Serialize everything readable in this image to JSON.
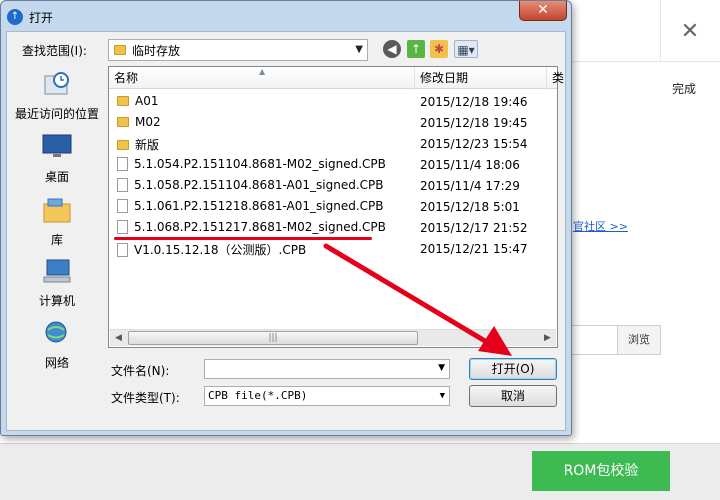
{
  "background_app": {
    "close_glyph": "✕",
    "done_label": "完成",
    "community_link": "官社区 >>",
    "browse_label": "浏览",
    "rom_button_label": "ROM包校验"
  },
  "dialog": {
    "title": "打开",
    "close_glyph": "✕",
    "look_in_label": "查找范围(I):",
    "look_in_value": "临时存放",
    "places": [
      {
        "label": "最近访问的位置"
      },
      {
        "label": "桌面"
      },
      {
        "label": "库"
      },
      {
        "label": "计算机"
      },
      {
        "label": "网络"
      }
    ],
    "columns": {
      "name": "名称",
      "date": "修改日期",
      "type": "类"
    },
    "files": [
      {
        "name": "A01",
        "date": "2015/12/18 19:46",
        "kind": "folder"
      },
      {
        "name": "M02",
        "date": "2015/12/18 19:45",
        "kind": "folder"
      },
      {
        "name": "新版",
        "date": "2015/12/23 15:54",
        "kind": "folder"
      },
      {
        "name": "5.1.054.P2.151104.8681-M02_signed.CPB",
        "date": "2015/11/4 18:06",
        "kind": "file"
      },
      {
        "name": "5.1.058.P2.151104.8681-A01_signed.CPB",
        "date": "2015/11/4 17:29",
        "kind": "file"
      },
      {
        "name": "5.1.061.P2.151218.8681-A01_signed.CPB",
        "date": "2015/12/18 5:01",
        "kind": "file"
      },
      {
        "name": "5.1.068.P2.151217.8681-M02_signed.CPB",
        "date": "2015/12/17 21:52",
        "kind": "file"
      },
      {
        "name": "V1.0.15.12.18（公测版）.CPB",
        "date": "2015/12/21 15:47",
        "kind": "file"
      }
    ],
    "filename_label": "文件名(N):",
    "filename_value": "",
    "filetype_label": "文件类型(T):",
    "filetype_value": "CPB file(*.CPB)",
    "open_button": "打开(O)",
    "cancel_button": "取消"
  },
  "colors": {
    "annotation_red": "#e4001b",
    "rom_green": "#3dbb52",
    "dialog_frame": "#c5d9ee"
  }
}
